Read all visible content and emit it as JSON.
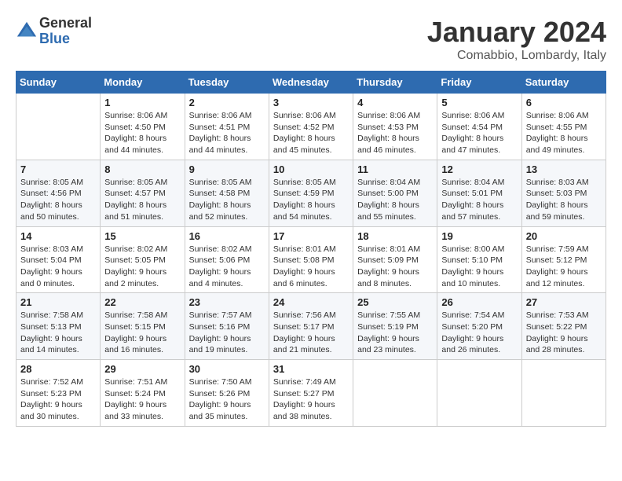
{
  "logo": {
    "general": "General",
    "blue": "Blue"
  },
  "title": "January 2024",
  "subtitle": "Comabbio, Lombardy, Italy",
  "weekdays": [
    "Sunday",
    "Monday",
    "Tuesday",
    "Wednesday",
    "Thursday",
    "Friday",
    "Saturday"
  ],
  "weeks": [
    [
      {
        "day": "",
        "sunrise": "",
        "sunset": "",
        "daylight": ""
      },
      {
        "day": "1",
        "sunrise": "Sunrise: 8:06 AM",
        "sunset": "Sunset: 4:50 PM",
        "daylight": "Daylight: 8 hours and 44 minutes."
      },
      {
        "day": "2",
        "sunrise": "Sunrise: 8:06 AM",
        "sunset": "Sunset: 4:51 PM",
        "daylight": "Daylight: 8 hours and 44 minutes."
      },
      {
        "day": "3",
        "sunrise": "Sunrise: 8:06 AM",
        "sunset": "Sunset: 4:52 PM",
        "daylight": "Daylight: 8 hours and 45 minutes."
      },
      {
        "day": "4",
        "sunrise": "Sunrise: 8:06 AM",
        "sunset": "Sunset: 4:53 PM",
        "daylight": "Daylight: 8 hours and 46 minutes."
      },
      {
        "day": "5",
        "sunrise": "Sunrise: 8:06 AM",
        "sunset": "Sunset: 4:54 PM",
        "daylight": "Daylight: 8 hours and 47 minutes."
      },
      {
        "day": "6",
        "sunrise": "Sunrise: 8:06 AM",
        "sunset": "Sunset: 4:55 PM",
        "daylight": "Daylight: 8 hours and 49 minutes."
      }
    ],
    [
      {
        "day": "7",
        "sunrise": "Sunrise: 8:05 AM",
        "sunset": "Sunset: 4:56 PM",
        "daylight": "Daylight: 8 hours and 50 minutes."
      },
      {
        "day": "8",
        "sunrise": "Sunrise: 8:05 AM",
        "sunset": "Sunset: 4:57 PM",
        "daylight": "Daylight: 8 hours and 51 minutes."
      },
      {
        "day": "9",
        "sunrise": "Sunrise: 8:05 AM",
        "sunset": "Sunset: 4:58 PM",
        "daylight": "Daylight: 8 hours and 52 minutes."
      },
      {
        "day": "10",
        "sunrise": "Sunrise: 8:05 AM",
        "sunset": "Sunset: 4:59 PM",
        "daylight": "Daylight: 8 hours and 54 minutes."
      },
      {
        "day": "11",
        "sunrise": "Sunrise: 8:04 AM",
        "sunset": "Sunset: 5:00 PM",
        "daylight": "Daylight: 8 hours and 55 minutes."
      },
      {
        "day": "12",
        "sunrise": "Sunrise: 8:04 AM",
        "sunset": "Sunset: 5:01 PM",
        "daylight": "Daylight: 8 hours and 57 minutes."
      },
      {
        "day": "13",
        "sunrise": "Sunrise: 8:03 AM",
        "sunset": "Sunset: 5:03 PM",
        "daylight": "Daylight: 8 hours and 59 minutes."
      }
    ],
    [
      {
        "day": "14",
        "sunrise": "Sunrise: 8:03 AM",
        "sunset": "Sunset: 5:04 PM",
        "daylight": "Daylight: 9 hours and 0 minutes."
      },
      {
        "day": "15",
        "sunrise": "Sunrise: 8:02 AM",
        "sunset": "Sunset: 5:05 PM",
        "daylight": "Daylight: 9 hours and 2 minutes."
      },
      {
        "day": "16",
        "sunrise": "Sunrise: 8:02 AM",
        "sunset": "Sunset: 5:06 PM",
        "daylight": "Daylight: 9 hours and 4 minutes."
      },
      {
        "day": "17",
        "sunrise": "Sunrise: 8:01 AM",
        "sunset": "Sunset: 5:08 PM",
        "daylight": "Daylight: 9 hours and 6 minutes."
      },
      {
        "day": "18",
        "sunrise": "Sunrise: 8:01 AM",
        "sunset": "Sunset: 5:09 PM",
        "daylight": "Daylight: 9 hours and 8 minutes."
      },
      {
        "day": "19",
        "sunrise": "Sunrise: 8:00 AM",
        "sunset": "Sunset: 5:10 PM",
        "daylight": "Daylight: 9 hours and 10 minutes."
      },
      {
        "day": "20",
        "sunrise": "Sunrise: 7:59 AM",
        "sunset": "Sunset: 5:12 PM",
        "daylight": "Daylight: 9 hours and 12 minutes."
      }
    ],
    [
      {
        "day": "21",
        "sunrise": "Sunrise: 7:58 AM",
        "sunset": "Sunset: 5:13 PM",
        "daylight": "Daylight: 9 hours and 14 minutes."
      },
      {
        "day": "22",
        "sunrise": "Sunrise: 7:58 AM",
        "sunset": "Sunset: 5:15 PM",
        "daylight": "Daylight: 9 hours and 16 minutes."
      },
      {
        "day": "23",
        "sunrise": "Sunrise: 7:57 AM",
        "sunset": "Sunset: 5:16 PM",
        "daylight": "Daylight: 9 hours and 19 minutes."
      },
      {
        "day": "24",
        "sunrise": "Sunrise: 7:56 AM",
        "sunset": "Sunset: 5:17 PM",
        "daylight": "Daylight: 9 hours and 21 minutes."
      },
      {
        "day": "25",
        "sunrise": "Sunrise: 7:55 AM",
        "sunset": "Sunset: 5:19 PM",
        "daylight": "Daylight: 9 hours and 23 minutes."
      },
      {
        "day": "26",
        "sunrise": "Sunrise: 7:54 AM",
        "sunset": "Sunset: 5:20 PM",
        "daylight": "Daylight: 9 hours and 26 minutes."
      },
      {
        "day": "27",
        "sunrise": "Sunrise: 7:53 AM",
        "sunset": "Sunset: 5:22 PM",
        "daylight": "Daylight: 9 hours and 28 minutes."
      }
    ],
    [
      {
        "day": "28",
        "sunrise": "Sunrise: 7:52 AM",
        "sunset": "Sunset: 5:23 PM",
        "daylight": "Daylight: 9 hours and 30 minutes."
      },
      {
        "day": "29",
        "sunrise": "Sunrise: 7:51 AM",
        "sunset": "Sunset: 5:24 PM",
        "daylight": "Daylight: 9 hours and 33 minutes."
      },
      {
        "day": "30",
        "sunrise": "Sunrise: 7:50 AM",
        "sunset": "Sunset: 5:26 PM",
        "daylight": "Daylight: 9 hours and 35 minutes."
      },
      {
        "day": "31",
        "sunrise": "Sunrise: 7:49 AM",
        "sunset": "Sunset: 5:27 PM",
        "daylight": "Daylight: 9 hours and 38 minutes."
      },
      {
        "day": "",
        "sunrise": "",
        "sunset": "",
        "daylight": ""
      },
      {
        "day": "",
        "sunrise": "",
        "sunset": "",
        "daylight": ""
      },
      {
        "day": "",
        "sunrise": "",
        "sunset": "",
        "daylight": ""
      }
    ]
  ]
}
